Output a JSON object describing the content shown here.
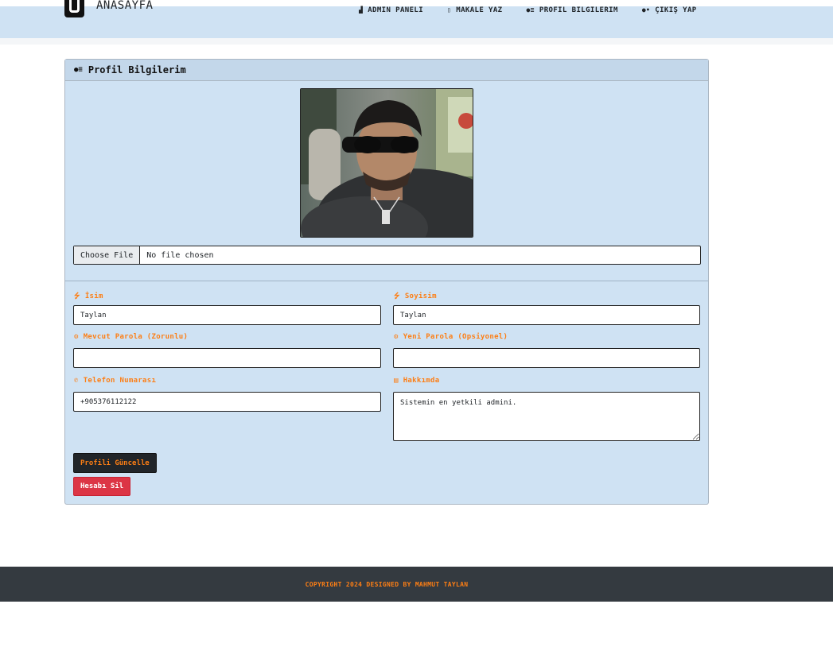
{
  "nav": {
    "brand": "ANASAYFA",
    "links": [
      {
        "icon": "gauge-icon",
        "glyph": "▟",
        "label": "ADMIN PANELI"
      },
      {
        "icon": "document-icon",
        "glyph": "▯",
        "label": "MAKALE YAZ"
      },
      {
        "icon": "user-card-icon",
        "glyph": "≡",
        "label": "PROFIL BILGILERIM"
      },
      {
        "icon": "user-logout-icon",
        "glyph": "•",
        "label": "ÇIKIŞ YAP"
      }
    ]
  },
  "card": {
    "title": "Profil Bilgilerim",
    "file_button": "Choose File",
    "file_status": "No file chosen"
  },
  "form": {
    "first_name": {
      "label": "İsim",
      "value": ""
    },
    "last_name": {
      "label": "Soyisim",
      "value": ""
    },
    "current_password": {
      "label": "Mevcut Parola (Zorunlu)",
      "value": ""
    },
    "new_password": {
      "label": "Yeni Parola (Opsiyonel)",
      "value": ""
    },
    "phone": {
      "label": "Telefon Numarası",
      "value": "+905376112122"
    },
    "about": {
      "label": "Hakkımda",
      "value": "Sistemin en yetkili admini."
    },
    "first_name_value": "Taylan",
    "last_name_value": "Taylan",
    "update_button": "Profili Güncelle",
    "delete_button": "Hesabı Sil"
  },
  "footer": {
    "text": "COPYRIGHT 2024 DESIGNED BY MAHMUT TAYLAN"
  },
  "colors": {
    "navbar_bg": "#cfe2f3",
    "card_bg": "#cfe2f3",
    "accent_orange": "#fd7e14",
    "danger": "#dc3545",
    "dark": "#212529",
    "footer_bg": "#343a40"
  }
}
